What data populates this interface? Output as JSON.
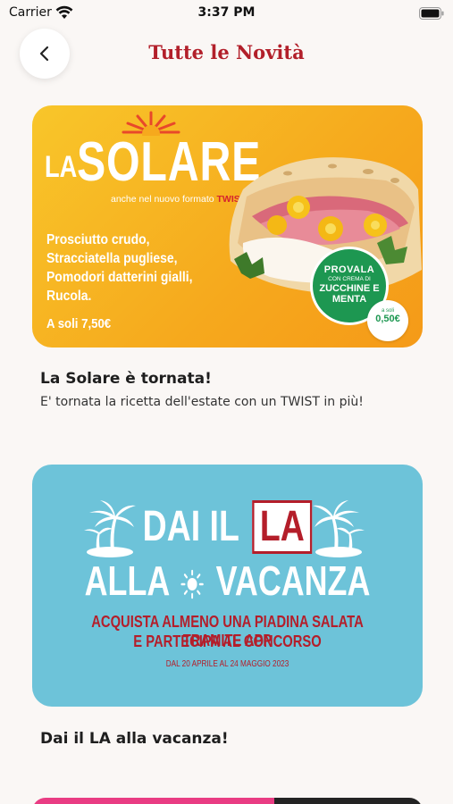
{
  "status_bar": {
    "carrier": "Carrier",
    "time": "3:37 PM"
  },
  "header": {
    "title": "Tutte le Novità",
    "back_icon": "chevron-left-icon"
  },
  "news": [
    {
      "banner": {
        "la": "LA",
        "brand": "SOLARE",
        "tagline_prefix": "anche nel nuovo formato ",
        "tagline_highlight": "TWIST",
        "description": "Prosciutto crudo, Stracciatella pugliese, Pomodori datterini gialli, Rucola.",
        "price": "A soli 7,50€",
        "promo_badge": {
          "line1": "PROVALA",
          "line2": "CON CREMA DI",
          "line3": "ZUCCHINE E MENTA"
        },
        "price_badge": {
          "prefix": "a soli",
          "value": "0,50€"
        }
      },
      "title": "La Solare è tornata!",
      "subtitle": "E' tornata la ricetta dell'estate con un TWIST in più!"
    },
    {
      "banner": {
        "line1_prefix": "DAI IL",
        "line1_box": "LA",
        "line2_left": "ALLA",
        "line2_right": "VACANZA",
        "line3": "ACQUISTA ALMENO UNA PIADINA SALATA TRAMITE APP",
        "line4": "E PARTECIPA AL CONCORSO",
        "line5": "DAL 20 APRILE AL 24 MAGGIO 2023"
      },
      "title": "Dai il LA alla vacanza!"
    }
  ],
  "colors": {
    "brand_red": "#b21f2a",
    "solare_yellow": "#f6a91d",
    "vacanza_blue": "#6dc3d9",
    "promo_green": "#1d9751"
  }
}
